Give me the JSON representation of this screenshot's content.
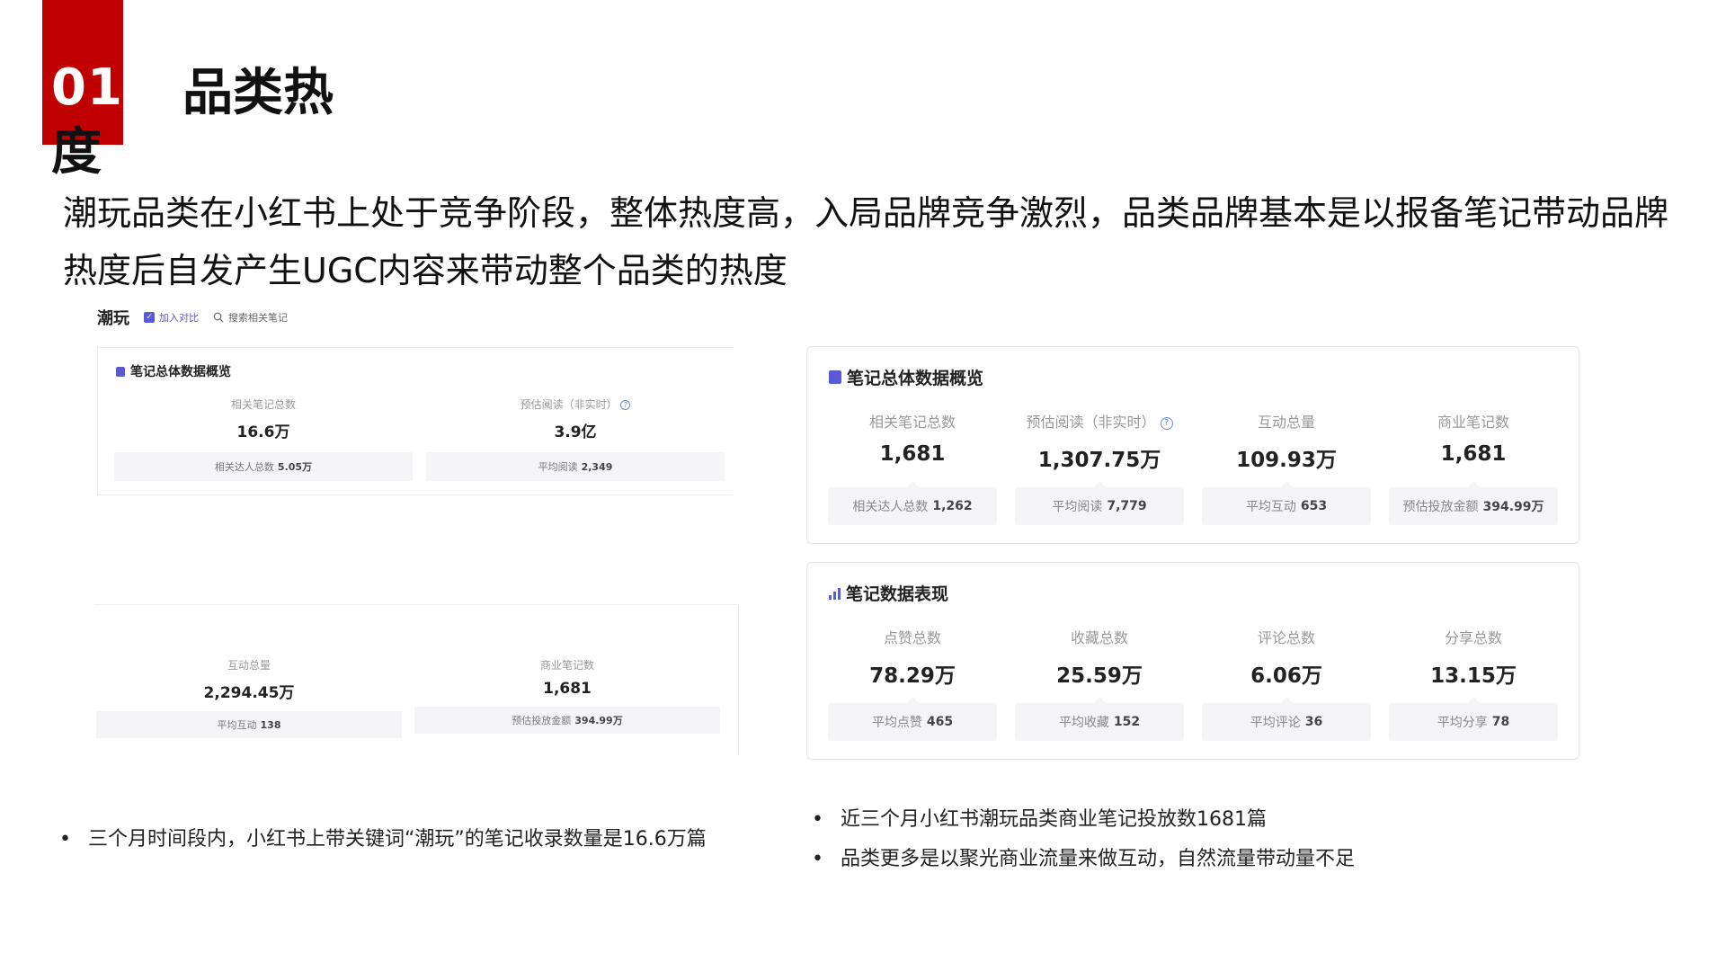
{
  "section": {
    "number": "01",
    "title_line1": "品类热",
    "title_line2": "度"
  },
  "intro_text": "潮玩品类在小红书上处于竞争阶段，整体热度高，入局品牌竞争激烈，品类品牌基本是以报备笔记带动品牌热度后自发产生UGC内容来带动整个品类的热度",
  "left_panel": {
    "category": "潮玩",
    "add_compare": "加入对比",
    "search_notes": "搜索相关笔记",
    "overview_title": "笔记总体数据概览",
    "metrics_top": [
      {
        "label": "相关笔记总数",
        "value": "16.6万",
        "sub_label": "相关达人总数",
        "sub_value": "5.05万"
      },
      {
        "label": "预估阅读（非实时）",
        "value": "3.9亿",
        "sub_label": "平均阅读",
        "sub_value": "2,349"
      }
    ],
    "metrics_bottom": [
      {
        "label": "互动总量",
        "value": "2,294.45万",
        "sub_label": "平均互动",
        "sub_value": "138"
      },
      {
        "label": "商业笔记数",
        "value": "1,681",
        "sub_label": "预估投放金额",
        "sub_value": "394.99万"
      }
    ]
  },
  "right_panel": {
    "overview_title": "笔记总体数据概览",
    "overview_metrics": [
      {
        "label": "相关笔记总数",
        "value": "1,681",
        "sub_label": "相关达人总数",
        "sub_value": "1,262"
      },
      {
        "label": "预估阅读（非实时）",
        "value": "1,307.75万",
        "sub_label": "平均阅读",
        "sub_value": "7,779"
      },
      {
        "label": "互动总量",
        "value": "109.93万",
        "sub_label": "平均互动",
        "sub_value": "653"
      },
      {
        "label": "商业笔记数",
        "value": "1,681",
        "sub_label": "预估投放金额",
        "sub_value": "394.99万"
      }
    ],
    "performance_title": "笔记数据表现",
    "performance_metrics": [
      {
        "label": "点赞总数",
        "value": "78.29万",
        "sub_label": "平均点赞",
        "sub_value": "465"
      },
      {
        "label": "收藏总数",
        "value": "25.59万",
        "sub_label": "平均收藏",
        "sub_value": "152"
      },
      {
        "label": "评论总数",
        "value": "6.06万",
        "sub_label": "平均评论",
        "sub_value": "36"
      },
      {
        "label": "分享总数",
        "value": "13.15万",
        "sub_label": "平均分享",
        "sub_value": "78"
      }
    ]
  },
  "bullets_left": [
    "三个月时间段内，小红书上带关键词“潮玩”的笔记收录数量是16.6万篇"
  ],
  "bullets_right": [
    "近三个月小红书潮玩品类商业笔记投放数1681篇",
    "品类更多是以聚光商业流量来做互动，自然流量带动量不足"
  ],
  "icons": [
    "checkbox-icon",
    "search-icon",
    "help-icon",
    "square-icon",
    "bar-chart-icon"
  ],
  "colors": {
    "accent_red": "#c00000",
    "accent_purple": "#5b5ad6",
    "help_blue": "#6b8fe0"
  }
}
